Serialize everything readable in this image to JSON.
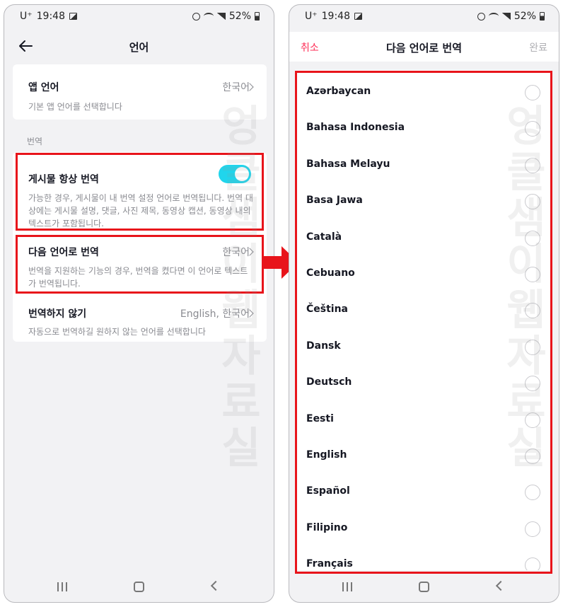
{
  "status_bar": {
    "carrier": "U⁺",
    "time": "19:48",
    "battery": "52%"
  },
  "left_screen": {
    "title": "언어",
    "app_language": {
      "title": "앱 언어",
      "value": "한국어",
      "description": "기본 앱 언어를 선택합니다"
    },
    "section_label": "번역",
    "always_translate": {
      "title": "게시물 항상 번역",
      "enabled": true,
      "description": "가능한 경우, 게시물이 내 번역 설정 언어로 번역됩니다. 번역 대상에는 게시물 설명, 댓글, 사진 제목, 동영상 캡션, 동영상 내의 텍스트가 포함됩니다."
    },
    "translate_into": {
      "title": "다음 언어로 번역",
      "value": "한국어",
      "description": "번역을 지원하는 기능의 경우, 번역을 켰다면 이 언어로 텍스트가 번역됩니다."
    },
    "dont_translate": {
      "title": "번역하지 않기",
      "value": "English, 한국어",
      "description": "자동으로 번역하길 원하지 않는 언어를 선택합니다"
    }
  },
  "right_screen": {
    "cancel_label": "취소",
    "title": "다음 언어로 번역",
    "done_label": "완료",
    "languages": [
      "Azərbaycan",
      "Bahasa Indonesia",
      "Bahasa Melayu",
      "Basa Jawa",
      "Català",
      "Cebuano",
      "Čeština",
      "Dansk",
      "Deutsch",
      "Eesti",
      "English",
      "Español",
      "Filipino",
      "Français"
    ]
  },
  "watermark_text": "엉클샘이웹자료실",
  "colors": {
    "accent_toggle": "#20d5ec",
    "cancel_red": "#fe2c55",
    "highlight_red": "#e8141b"
  }
}
